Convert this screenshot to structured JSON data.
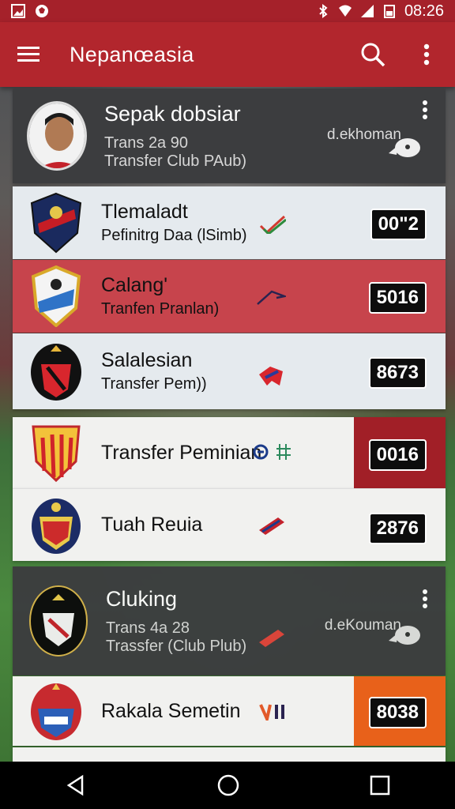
{
  "status_bar": {
    "time": "08:26"
  },
  "app_bar": {
    "title": "Nepanœasia"
  },
  "cards": {
    "profile": {
      "title": "Sepak dobsiar",
      "line1": "Trans 2a 90",
      "line2": "Transfer Club PAub)",
      "note": "d.ekhoman"
    },
    "row1": {
      "title": "Tlemaladt",
      "subtitle": "Pefinitrg Daa (lSimb)",
      "score": "00\"2"
    },
    "row2": {
      "title": "Calang'",
      "subtitle": "Tranfen Pranlan)",
      "score": "5016"
    },
    "row3": {
      "title": "Salalesian",
      "subtitle": "Transfer Pem))",
      "score": "8673"
    },
    "row4": {
      "title": "Transfer Peminian",
      "score": "0016"
    },
    "row5": {
      "title": "Tuah Reuia",
      "score": "2876"
    },
    "profile2": {
      "title": "Cluking",
      "line1": "Trans 4a 28",
      "line2": "Trassfer (Club Plub)",
      "note": "d.eKouman"
    },
    "row6": {
      "title": "Rakala Semetin",
      "score": "8038"
    }
  },
  "colors": {
    "primary": "#b2262d",
    "accent_orange": "#e8611a",
    "dark_red": "#a5212a"
  }
}
